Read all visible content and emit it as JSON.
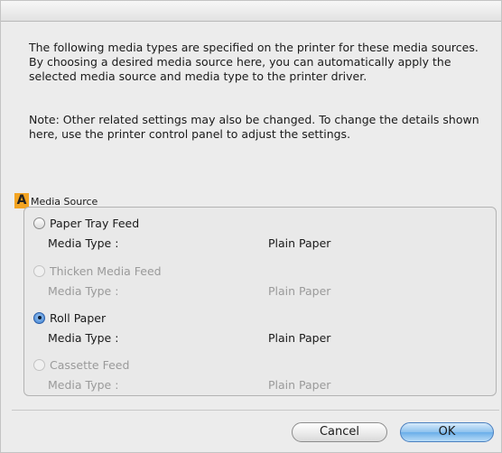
{
  "description": {
    "lines": [
      "The following media types are specified on the printer for these media sources.",
      "By choosing a desired media source here, you can automatically apply the",
      "selected media source and media type to the printer driver."
    ]
  },
  "note": {
    "lines": [
      "Note: Other related settings may also be changed. To change the details shown",
      "here, use the printer control panel to adjust the settings."
    ]
  },
  "media_source": {
    "badge": "A",
    "label": "Media Source",
    "media_type_label": "Media Type :",
    "options": [
      {
        "name": "Paper Tray Feed",
        "media_type": "Plain Paper",
        "checked": false,
        "enabled": true
      },
      {
        "name": "Thicken Media Feed",
        "media_type": "Plain Paper",
        "checked": false,
        "enabled": false
      },
      {
        "name": "Roll Paper",
        "media_type": "Plain Paper",
        "checked": true,
        "enabled": true
      },
      {
        "name": "Cassette Feed",
        "media_type": "Plain Paper",
        "checked": false,
        "enabled": false
      }
    ]
  },
  "buttons": {
    "cancel": "Cancel",
    "ok": "OK"
  }
}
